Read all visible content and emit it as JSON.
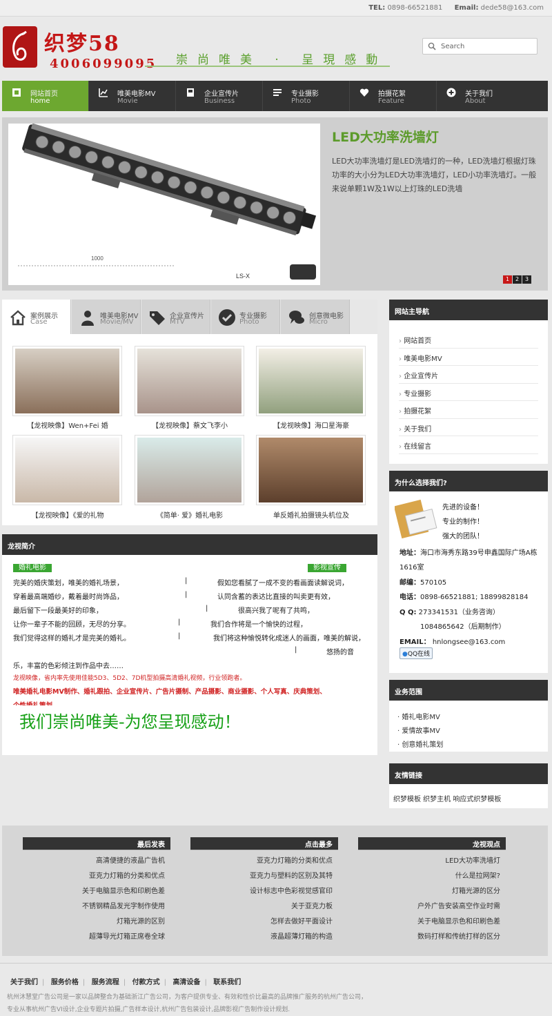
{
  "topbar": {
    "tel_label": "TEL:",
    "tel": "0898-66521881",
    "email_label": "Email:",
    "email": "dede58@163.com"
  },
  "logo": {
    "brand": "织梦58",
    "phone": "4006099095",
    "slogan": "崇尚唯美 · 呈現感動"
  },
  "search": {
    "placeholder": "Search"
  },
  "nav": [
    {
      "cn": "网站首页",
      "en": "home",
      "icon": "home-icon",
      "active": true
    },
    {
      "cn": "唯美电影MV",
      "en": "Movie",
      "icon": "chart-icon"
    },
    {
      "cn": "企业宣传片",
      "en": "Business",
      "icon": "square-icon"
    },
    {
      "cn": "专业摄影",
      "en": "Photo",
      "icon": "list-icon"
    },
    {
      "cn": "拍摄花絮",
      "en": "Feature",
      "icon": "heart-icon"
    },
    {
      "cn": "关于我们",
      "en": "About",
      "icon": "plus-icon"
    }
  ],
  "banner": {
    "title": "LED大功率洗墙灯",
    "desc": "LED大功率洗墙灯是LED洗墙灯的一种，LED洗墙灯根据灯珠功率的大小分为LED大功率洗墙灯，LED小功率洗墙灯。一般来说单颗1W及1W以上灯珠的LED洗墙",
    "image_text": "1000",
    "image_model": "LS-X",
    "pages": [
      "1",
      "2",
      "3"
    ]
  },
  "tabs": [
    {
      "cn": "案例展示",
      "en": "Case",
      "icon": "house-icon",
      "active": true
    },
    {
      "cn": "唯美电影MV",
      "en": "Movie/MV",
      "icon": "person-icon"
    },
    {
      "cn": "企业宣传片",
      "en": "MTV",
      "icon": "tag-icon"
    },
    {
      "cn": "专业摄影",
      "en": "Photo",
      "icon": "check-circle-icon"
    },
    {
      "cn": "创意微电影",
      "en": "Micro",
      "icon": "chat-icon"
    }
  ],
  "gallery": [
    {
      "caption": "【龙视映像】Wen+Fei 婚",
      "c1": "#d7cfc4",
      "c2": "#8a6f5a"
    },
    {
      "caption": "【龙视映像】蔡文飞李小",
      "c1": "#e6e2da",
      "c2": "#a8938a"
    },
    {
      "caption": "【龙视映像】海口星海豪",
      "c1": "#f3efe6",
      "c2": "#91a07e"
    },
    {
      "caption": "【龙视映像】《爱的礼物",
      "c1": "#f6f6f6",
      "c2": "#c9b8a8"
    },
    {
      "caption": "《简单· 爱》婚礼电影",
      "c1": "#d9ebe9",
      "c2": "#b1a39a"
    },
    {
      "caption": "单反婚礼拍摄镜头机位及",
      "c1": "#b08a6a",
      "c2": "#5c3f2c"
    }
  ],
  "about": {
    "title": "龙视简介",
    "tag1": "婚礼电影",
    "tag2": "影视宣传",
    "l1": "完美的婚庆策划，唯美的婚礼场景，",
    "l2": "穿着最高端婚纱，戴着最时尚饰品，",
    "l3": "最后留下一段最美好的印象，",
    "l4": "让你一辈子不能的回顾，无尽的分享。",
    "l5": "我们觉得这样的婚礼才是完美的婚礼。",
    "r1": "假如您看腻了一成不变的看画面读解说词，",
    "r2": "认同含蓄的表达比直接的叫卖更有效，",
    "r3": "很高兴我了呢有了共鸣，",
    "r4": "我们合作将是一个愉快的过程，",
    "r5": "我们将这种愉悦转化成迷人的画面，唯美的解说，",
    "r6": "悠扬的音",
    "cont": "乐，丰富的色彩倾注到作品中去……",
    "sep": "|",
    "red1": "龙视映像，省内率先使用佳能5D3、5D2、7D机型拍摄高清婚礼视频，行业领跑者。",
    "red2": "唯美婚礼电影MV制作、婚礼跟拍、企业宣传片、广告片摄制、产品摄影、商业摄影、个人写真、庆典策划、",
    "red3": "个性婚礼策划……",
    "big": "我们崇尚唯美-为您呈现感动！"
  },
  "sidebar": {
    "nav_title": "网站主导航",
    "nav_items": [
      "网站首页",
      "唯美电影MV",
      "企业宣传片",
      "专业摄影",
      "拍摄花絮",
      "关于我们",
      "在线留言"
    ],
    "why_title": "为什么选择我们?",
    "why_points": [
      "先进的设备！",
      "专业的制作！",
      "强大的团队！"
    ],
    "addr_label": "地址：",
    "addr": "海口市海秀东路39号申鑫国际广场A栋",
    "addr2": "1616室",
    "zip_label": "邮编：",
    "zip": "570105",
    "tel_label": "电话：",
    "tel": "0898-66521881; 18899828184",
    "qq_label": "Q  Q:",
    "qq1": "273341531（业务咨询）",
    "qq2": "1084865642（后期制作）",
    "email_label": "EMAIL：",
    "email": "hnlongsee@163.com",
    "qq_btn": "QQ在线",
    "scope_title": "业务范围",
    "scope_items": [
      "婚礼电影MV",
      "爱情故事MV",
      "创意婚礼策划"
    ],
    "links_title": "友情链接",
    "links": "织梦模板 织梦主机 响应式织梦模板"
  },
  "footer": [
    {
      "title": "最后发表",
      "items": [
        "高清便捷的液晶广告机",
        "亚克力灯箱的分类和优点",
        "关于电脑显示色和印刷色差",
        "不锈钢精品发光字制作使用",
        "灯箱光源的区别",
        "超薄导光灯箱正席卷全球"
      ]
    },
    {
      "title": "点击最多",
      "items": [
        "亚克力灯箱的分类和优点",
        "亚克力与塑料的区别及其特",
        "设计标志中色彩视觉感官印",
        "关于亚克力板",
        "怎样去做好平面设计",
        "液晶超薄灯箱的构造"
      ]
    },
    {
      "title": "龙视观点",
      "items": [
        "LED大功率洗墙灯",
        "什么是拉网架?",
        "灯箱光源的区分",
        "户外广告安装高空作业时需",
        "关于电脑显示色和印刷色差",
        "数码打样和传统打样的区分"
      ]
    }
  ],
  "bottom": {
    "menu": [
      "关于我们",
      "服务价格",
      "服务流程",
      "付款方式",
      "高清设备",
      "联系我们"
    ],
    "sep": "|",
    "copy1": "杭州沐慧堂广告公司是一家以品牌整合为基础浙江广告公司，为客户提供专业、有效和性价比最高的品牌推广服务的杭州广告公司，",
    "copy2": "专业从事杭州广告VI设计,企业专题片拍摄,广告样本设计,杭州广告包装设计,品牌影视广告制作设计规划."
  },
  "colors": {
    "green": "#6da830",
    "red": "#c41717",
    "dark": "#333333"
  }
}
